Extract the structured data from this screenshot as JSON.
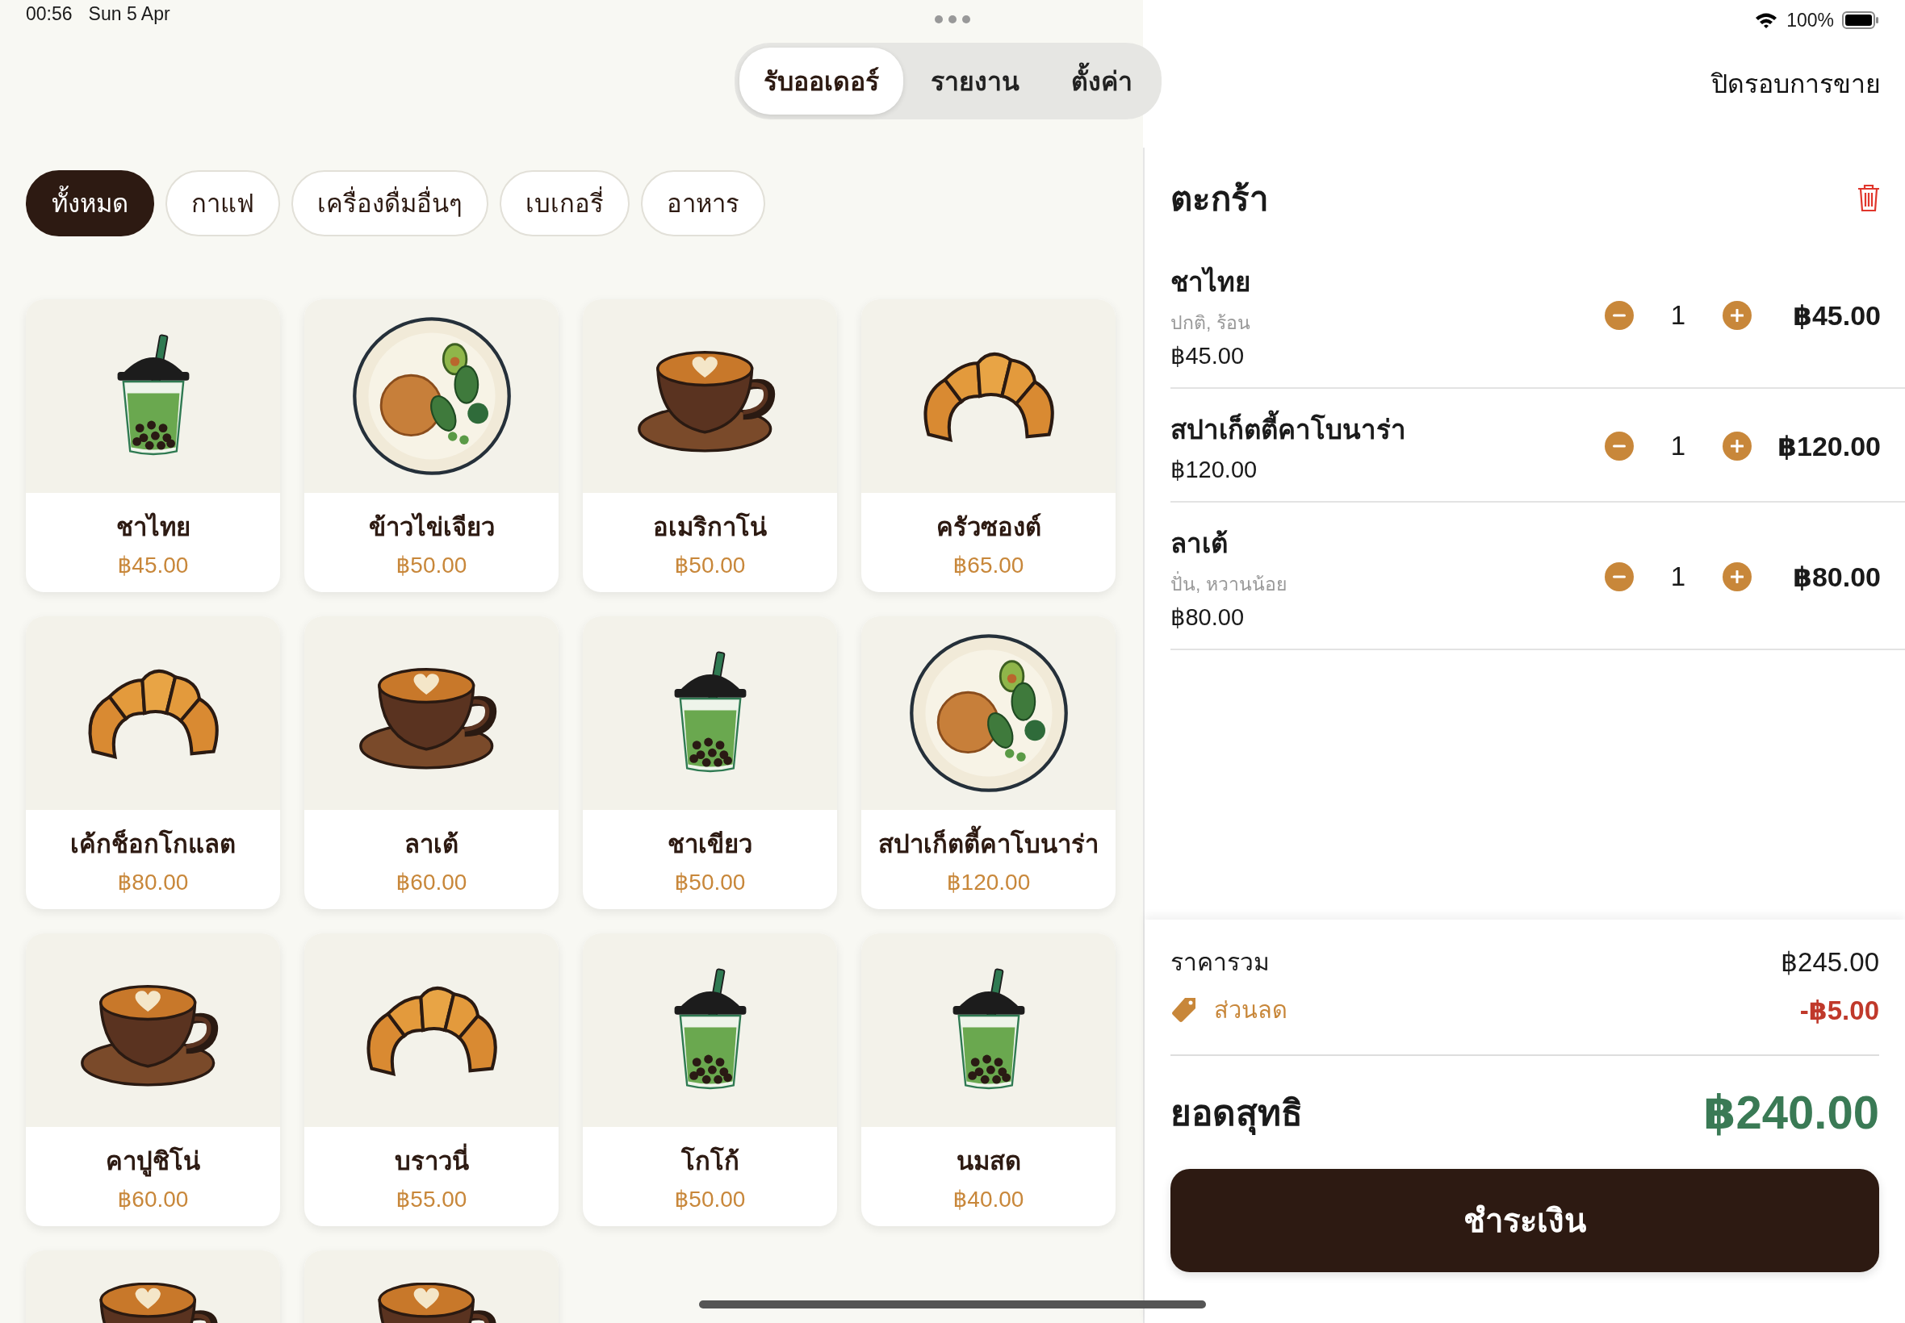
{
  "status_bar": {
    "time": "00:56",
    "date": "Sun 5 Apr",
    "battery": "100%"
  },
  "nav": {
    "tabs": [
      {
        "label": "รับออเดอร์",
        "selected": true
      },
      {
        "label": "รายงาน",
        "selected": false
      },
      {
        "label": "ตั้งค่า",
        "selected": false
      }
    ],
    "close_shift": "ปิดรอบการขาย"
  },
  "categories": [
    {
      "label": "ทั้งหมด",
      "selected": true
    },
    {
      "label": "กาแฟ",
      "selected": false
    },
    {
      "label": "เครื่องดื่มอื่นๆ",
      "selected": false
    },
    {
      "label": "เบเกอรี่",
      "selected": false
    },
    {
      "label": "อาหาร",
      "selected": false
    }
  ],
  "products": [
    {
      "name": "ชาไทย",
      "price": "฿45.00",
      "kind": "boba"
    },
    {
      "name": "ข้าวไข่เจียว",
      "price": "฿50.00",
      "kind": "plate"
    },
    {
      "name": "อเมริกาโน่",
      "price": "฿50.00",
      "kind": "coffee"
    },
    {
      "name": "ครัวซองต์",
      "price": "฿65.00",
      "kind": "croissant"
    },
    {
      "name": "เค้กช็อกโกแลต",
      "price": "฿80.00",
      "kind": "croissant"
    },
    {
      "name": "ลาเต้",
      "price": "฿60.00",
      "kind": "coffee"
    },
    {
      "name": "ชาเขียว",
      "price": "฿50.00",
      "kind": "boba"
    },
    {
      "name": "สปาเก็ตตี้คาโบนาร่า",
      "price": "฿120.00",
      "kind": "plate"
    },
    {
      "name": "คาปูชิโน่",
      "price": "฿60.00",
      "kind": "coffee"
    },
    {
      "name": "บราวนี่",
      "price": "฿55.00",
      "kind": "croissant"
    },
    {
      "name": "โกโก้",
      "price": "฿50.00",
      "kind": "boba"
    },
    {
      "name": "นมสด",
      "price": "฿40.00",
      "kind": "boba"
    },
    {
      "kind": "coffee"
    },
    {
      "kind": "coffee"
    }
  ],
  "cart": {
    "title": "ตะกร้า",
    "items": [
      {
        "name": "ชาไทย",
        "options": "ปกติ, ร้อน",
        "unit_price": "฿45.00",
        "quantity": "1",
        "total": "฿45.00"
      },
      {
        "name": "สปาเก็ตตี้คาโบนาร่า",
        "unit_price": "฿120.00",
        "quantity": "1",
        "total": "฿120.00"
      },
      {
        "name": "ลาเต้",
        "options": "ปั่น, หวานน้อย",
        "unit_price": "฿80.00",
        "quantity": "1",
        "total": "฿80.00"
      }
    ],
    "summary": {
      "subtotal_label": "ราคารวม",
      "subtotal": "฿245.00",
      "discount_label": "ส่วนลด",
      "discount": "-฿5.00",
      "net_label": "ยอดสุทธิ",
      "net": "฿240.00"
    },
    "pay_button": "ชำระเงิน"
  }
}
